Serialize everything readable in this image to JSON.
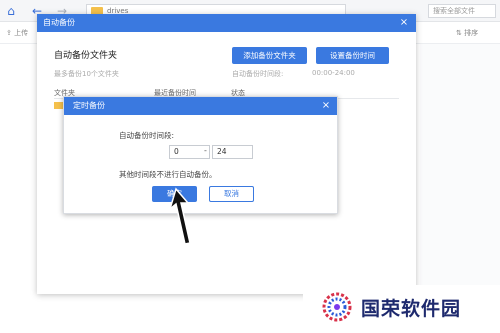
{
  "toolbar": {
    "path_text": "drives",
    "search_placeholder": "搜索全部文件",
    "upload_label": "上传",
    "sort_label": "排序"
  },
  "main_dialog": {
    "header_title": "自动备份",
    "close_glyph": "×",
    "title": "自动备份文件夹",
    "subtitle": "最多备份10个文件夹",
    "add_button": "添加备份文件夹",
    "set_button": "设置备份时间",
    "range_label": "自动备份时间段:",
    "range_value": "00:00-24:00",
    "columns": [
      "文件夹",
      "最近备份时间",
      "状态"
    ]
  },
  "sub_dialog": {
    "header_title": "定时备份",
    "close_glyph": "×",
    "period_label": "自动备份时间段:",
    "from_value": "0",
    "separator": "-",
    "to_value": "24",
    "note": "其他时间段不进行自动备份。",
    "ok_button": "确定",
    "cancel_button": "取消"
  },
  "watermark": {
    "text": "国荣软件园"
  },
  "colors": {
    "accent": "#3a79e0",
    "folder": "#f5c14c",
    "watermark_text": "#1e2a6e"
  }
}
